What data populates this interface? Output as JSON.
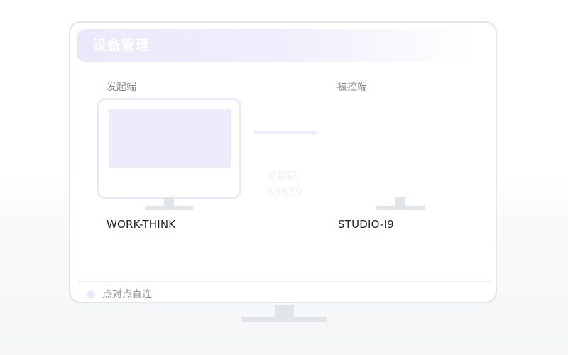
{
  "header": {
    "title": "设备管理"
  },
  "initiator": {
    "label": "发起端",
    "device_name": "WORK-THINK"
  },
  "controlled": {
    "label": "被控端",
    "device_name": "STUDIO-I9"
  },
  "connection": {
    "code_label": "识别码",
    "code_value": "60639"
  },
  "footer": {
    "mode_label": "点对点直连"
  },
  "colors": {
    "accent_light": "#eeebfc",
    "stand": "#e1e4e9",
    "border": "#e2e4ea"
  }
}
